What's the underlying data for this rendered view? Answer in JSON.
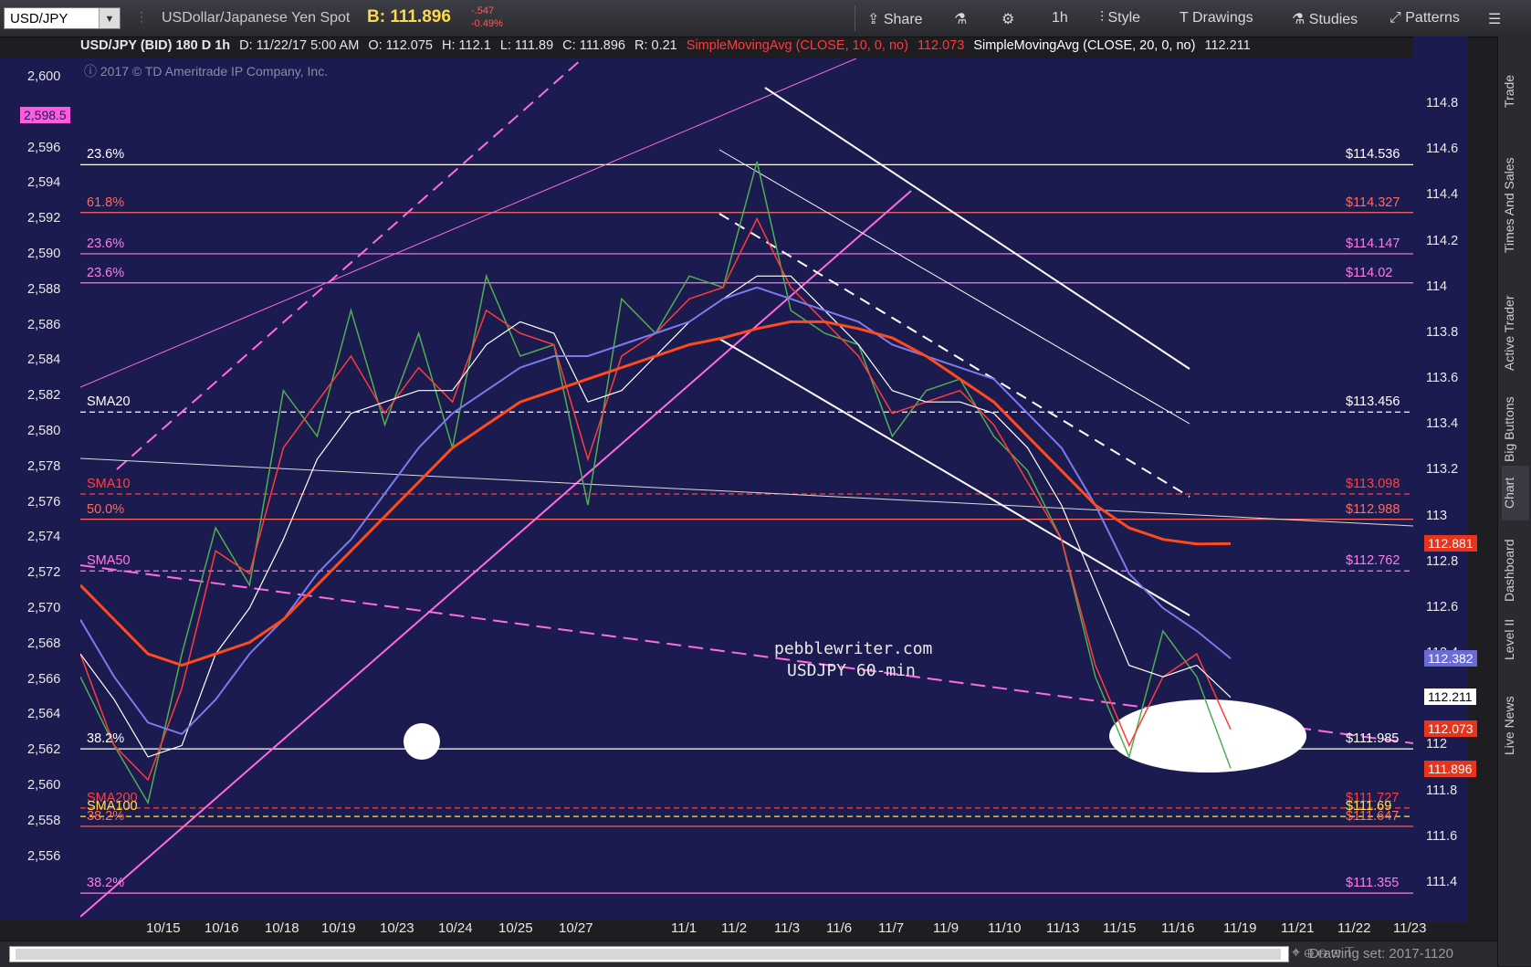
{
  "toolbar": {
    "symbol": "USD/JPY",
    "description": "USDollar/Japanese Yen Spot",
    "bid": "B: 111.896",
    "change": "-.547",
    "change_pct": "-0.49%",
    "share": "Share",
    "timeframe": "1h",
    "style": "Style",
    "drawings": "Drawings",
    "studies": "Studies",
    "patterns": "Patterns"
  },
  "header": {
    "title": "USD/JPY (BID) 180 D 1h",
    "date": "D: 11/22/17 5:00 AM",
    "open": "O: 112.075",
    "high": "H: 112.1",
    "low": "L: 111.89",
    "close": "C: 111.896",
    "range": "R: 0.21",
    "sma10": "SimpleMovingAvg (CLOSE, 10, 0, no)",
    "sma10_val": "112.073",
    "sma20": "SimpleMovingAvg (CLOSE, 20, 0, no)",
    "sma20_val": "112.211",
    "copyright": "2017 © TD Ameritrade IP Company, Inc."
  },
  "sidebar": [
    "Trade",
    "Times And Sales",
    "Active Trader",
    "Big Buttons",
    "Chart",
    "Dashboard",
    "Level II",
    "Live News"
  ],
  "bottom": {
    "drawing_set": "Drawing set: 2017-1120"
  },
  "annotation": {
    "line1": "pebblewriter.com",
    "line2": "USDJPY 60-min"
  },
  "left_levels": [
    {
      "text": "23.6%",
      "color": "#ffffff"
    },
    {
      "text": "61.8%",
      "color": "#ff6b5b"
    },
    {
      "text": "23.6%",
      "color": "#ff7be6"
    },
    {
      "text": "23.6%",
      "color": "#ff7be6"
    },
    {
      "text": "SMA20",
      "color": "#ffffff"
    },
    {
      "text": "SMA10",
      "color": "#ff4040"
    },
    {
      "text": "50.0%",
      "color": "#ff6b5b"
    },
    {
      "text": "SMA50",
      "color": "#ff7be6"
    },
    {
      "text": "38.2%",
      "color": "#ffffff"
    },
    {
      "text": "SMA200",
      "color": "#ff4040"
    },
    {
      "text": "SMA100",
      "color": "#ffe84a"
    },
    {
      "text": "38.2%",
      "color": "#ff6b5b"
    },
    {
      "text": "38.2%",
      "color": "#ff7be6"
    }
  ],
  "right_levels": [
    {
      "text": "$114.536",
      "color": "#ffffff"
    },
    {
      "text": "$114.327",
      "color": "#ff6b5b"
    },
    {
      "text": "$114.147",
      "color": "#ff7be6"
    },
    {
      "text": "$114.02",
      "color": "#ff7be6"
    },
    {
      "text": "$113.456",
      "color": "#ffffff"
    },
    {
      "text": "$113.098",
      "color": "#ff4040"
    },
    {
      "text": "$112.988",
      "color": "#ff6b5b"
    },
    {
      "text": "$112.762",
      "color": "#ff7be6"
    },
    {
      "text": "$111.985",
      "color": "#ffffff"
    },
    {
      "text": "$111.727",
      "color": "#ff4040"
    },
    {
      "text": "$111.69",
      "color": "#ffe84a"
    },
    {
      "text": "$111.647",
      "color": "#ff6b5b"
    },
    {
      "text": "$111.355",
      "color": "#ff7be6"
    }
  ],
  "price_tags": [
    {
      "text": "112.881",
      "bg": "#e8341c",
      "fg": "#ffffff"
    },
    {
      "text": "112.382",
      "bg": "#6b6bd8",
      "fg": "#ffffff"
    },
    {
      "text": "112.211",
      "bg": "#ffffff",
      "fg": "#000000"
    },
    {
      "text": "112.073",
      "bg": "#e8341c",
      "fg": "#ffffff"
    },
    {
      "text": "111.896",
      "bg": "#e8341c",
      "fg": "#ffffff"
    }
  ],
  "left_tag": "2,598.5",
  "chart_data": {
    "type": "line",
    "title": "USD/JPY (BID) 180 D 1h",
    "x_ticks": [
      "10/15",
      "10/16",
      "10/18",
      "10/19",
      "10/23",
      "10/24",
      "10/25",
      "10/27",
      "11/1",
      "11/2",
      "11/3",
      "11/6",
      "11/7",
      "11/9",
      "11/10",
      "11/13",
      "11/15",
      "11/16",
      "11/19",
      "11/21",
      "11/22",
      "11/23"
    ],
    "y_right_ticks": [
      "114.8",
      "114.6",
      "114.4",
      "114.2",
      "114",
      "113.8",
      "113.6",
      "113.4",
      "113.2",
      "113",
      "112.8",
      "112.6",
      "112.4",
      "112.2",
      "112",
      "111.8",
      "111.6",
      "111.4"
    ],
    "y_left_ticks": [
      "2,600",
      "2,598",
      "2,596",
      "2,594",
      "2,592",
      "2,590",
      "2,588",
      "2,586",
      "2,584",
      "2,582",
      "2,580",
      "2,578",
      "2,576",
      "2,574",
      "2,572",
      "2,570",
      "2,568",
      "2,566",
      "2,564",
      "2,562",
      "2,560",
      "2,558",
      "2,556"
    ],
    "ylim_right": [
      111.24,
      115.0
    ],
    "series": [
      {
        "name": "USD/JPY close",
        "values": [
          112.3,
          112.0,
          111.75,
          112.4,
          112.95,
          112.7,
          113.55,
          113.35,
          113.9,
          113.4,
          113.8,
          113.3,
          114.05,
          113.7,
          113.75,
          113.05,
          113.95,
          113.8,
          114.05,
          114.0,
          114.55,
          113.9,
          113.8,
          113.75,
          113.35,
          113.55,
          113.6,
          113.35,
          113.2,
          112.9,
          112.3,
          111.95,
          112.5,
          112.3,
          111.9
        ]
      },
      {
        "name": "SimpleMovingAvg (CLOSE, 10, 0, no)",
        "values": [
          112.4,
          112.0,
          111.85,
          112.25,
          112.85,
          112.75,
          113.3,
          113.5,
          113.7,
          113.45,
          113.65,
          113.5,
          113.9,
          113.8,
          113.75,
          113.25,
          113.7,
          113.8,
          113.95,
          114.0,
          114.3,
          114.0,
          113.85,
          113.7,
          113.45,
          113.5,
          113.55,
          113.4,
          113.15,
          112.9,
          112.35,
          112.0,
          112.3,
          112.4,
          112.07
        ]
      },
      {
        "name": "SimpleMovingAvg (CLOSE, 20, 0, no)",
        "values": [
          112.4,
          112.2,
          111.95,
          112.0,
          112.4,
          112.6,
          112.9,
          113.25,
          113.45,
          113.5,
          113.55,
          113.55,
          113.75,
          113.85,
          113.8,
          113.5,
          113.55,
          113.7,
          113.85,
          113.95,
          114.05,
          114.05,
          113.9,
          113.75,
          113.55,
          113.5,
          113.5,
          113.45,
          113.3,
          113.05,
          112.7,
          112.35,
          112.3,
          112.35,
          112.21
        ]
      },
      {
        "name": "SMA50",
        "values": [
          112.55,
          112.3,
          112.1,
          112.05,
          112.2,
          112.4,
          112.55,
          112.75,
          112.9,
          113.1,
          113.3,
          113.45,
          113.55,
          113.65,
          113.7,
          113.7,
          113.75,
          113.8,
          113.85,
          113.95,
          114.0,
          113.95,
          113.9,
          113.85,
          113.75,
          113.7,
          113.65,
          113.6,
          113.45,
          113.3,
          113.05,
          112.75,
          112.6,
          112.5,
          112.38
        ]
      },
      {
        "name": "SMA200",
        "values": [
          112.7,
          112.55,
          112.4,
          112.35,
          112.4,
          112.45,
          112.55,
          112.7,
          112.85,
          113.0,
          113.15,
          113.3,
          113.4,
          113.5,
          113.55,
          113.6,
          113.65,
          113.7,
          113.75,
          113.78,
          113.82,
          113.85,
          113.85,
          113.82,
          113.78,
          113.7,
          113.6,
          113.5,
          113.35,
          113.2,
          113.05,
          112.95,
          112.9,
          112.88,
          112.881
        ]
      }
    ]
  }
}
